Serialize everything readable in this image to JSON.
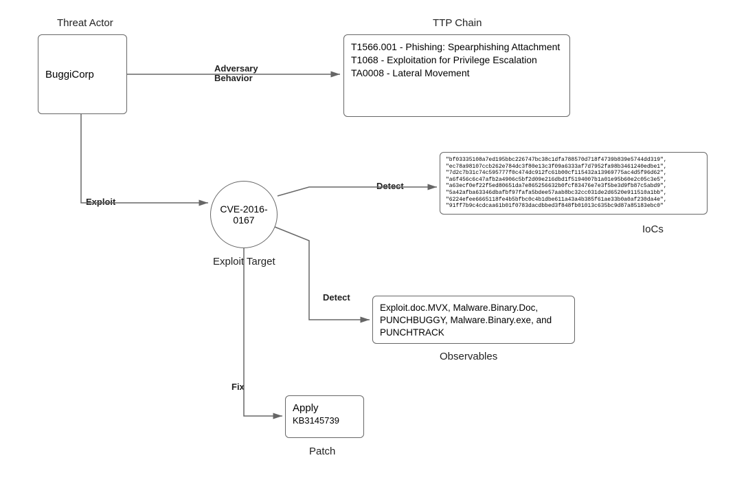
{
  "threat_actor": {
    "label": "Threat Actor",
    "name": "BuggiCorp"
  },
  "ttp_chain": {
    "label": "TTP Chain",
    "items": [
      "T1566.001 - Phishing: Spearphishing Attachment",
      "T1068 - Exploitation for Privilege Escalation",
      "TA0008 - Lateral Movement"
    ]
  },
  "exploit_target": {
    "label": "Exploit Target",
    "name": "CVE-2016-0167"
  },
  "iocs": {
    "label": "IoCs",
    "hashes": [
      "\"bf03335108a7ed195bbc226747bc38c1dfa788570d718f4739b839e5744dd319\",",
      "\"ec78a98107ccb262e784dc3f80e13c3f09a6333af7d7952fa98b3461240edbe1\",",
      "\"7d2c7b31c74c595777f0c474dc912fc61b00cf115432a13969775ac4d5f96d62\",",
      "\"a6f456c6c47afb2a4906c5bf2d09e216dbd1f5194007b1a01e95b60e2c05c3e5\",",
      "\"a63ecf0ef22f5ed80651da7e865256632b0fcf83476e7e3f5be3d9fb87c5abd9\",",
      "\"5a42afba63346dbafbf97fafa5bdee57aab8bc32cc031de2d6520e911510a1bb\",",
      "\"6224efee6665118fe4b5bfbc0c4b1dbe611a43a4b385f61ae33b0a0af230da4e\",",
      "\"91ff7b9c4cdcaa61b01f0783dacdbbed3f848fb01013c635bc9d87a85183ebc0\""
    ]
  },
  "observables": {
    "label": "Observables",
    "text": "Exploit.doc.MVX, Malware.Binary.Doc, PUNCHBUGGY, Malware.Binary.exe, and PUNCHTRACK"
  },
  "patch": {
    "label": "Patch",
    "title": "Apply",
    "kb": "KB3145739"
  },
  "edges": {
    "adversary": "Adversary Behavior",
    "exploit": "Exploit",
    "detect": "Detect",
    "fix": "Fix"
  }
}
